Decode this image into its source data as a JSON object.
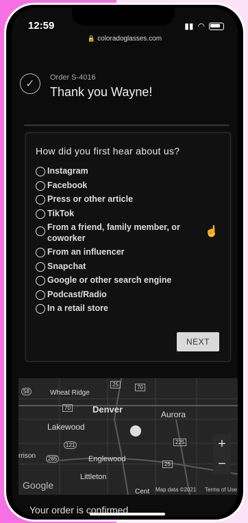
{
  "status_bar": {
    "time": "12:59"
  },
  "browser": {
    "url": "coloradoglasses.com"
  },
  "order": {
    "number": "Order S-4016",
    "thanks": "Thank you Wayne!"
  },
  "survey": {
    "question": "How did you first hear about us?",
    "options": [
      "Instagram",
      "Facebook",
      "Press or other article",
      "TikTok",
      "From a friend, family member, or coworker",
      "From an influencer",
      "Snapchat",
      "Google or other search engine",
      "Podcast/Radio",
      "In a retail store"
    ],
    "next_label": "NEXT"
  },
  "map": {
    "places": {
      "wheat_ridge": "Wheat Ridge",
      "denver": "Denver",
      "aurora": "Aurora",
      "lakewood": "Lakewood",
      "englewood": "Englewood",
      "littleton": "Littleton",
      "arrison": "rrison"
    },
    "shields": {
      "s58": "58",
      "s25a": "25",
      "s70a": "70",
      "s70b": "70",
      "s121": "121",
      "s285": "285",
      "s225": "225",
      "s25b": "25"
    },
    "google_logo": "Google",
    "attribution": "Map data ©2021",
    "terms": "Terms of Use",
    "partial_label": "Cent",
    "zoom_in": "+",
    "zoom_out": "−"
  },
  "footer": {
    "confirm_text": "Your order is confirmed"
  }
}
